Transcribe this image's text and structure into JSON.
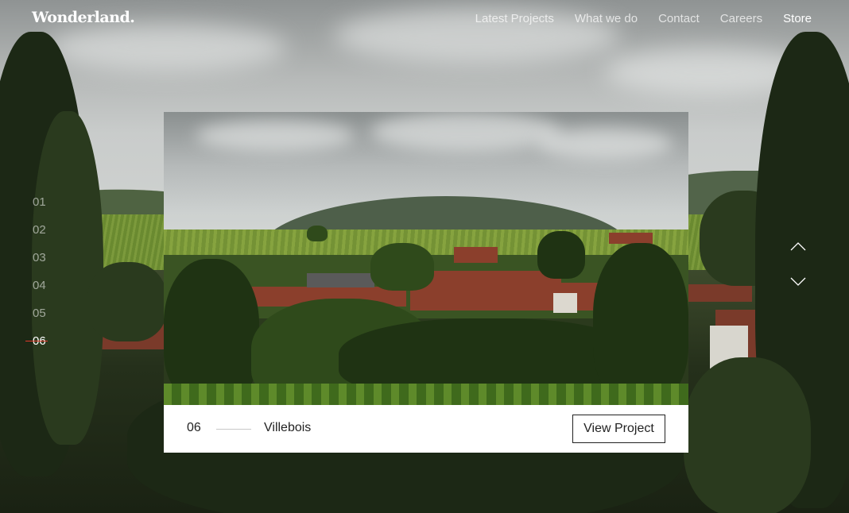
{
  "header": {
    "logo": "Wonderland.",
    "nav": [
      {
        "label": "Latest Projects",
        "active": false
      },
      {
        "label": "What we do",
        "active": false
      },
      {
        "label": "Contact",
        "active": false
      },
      {
        "label": "Careers",
        "active": false
      },
      {
        "label": "Store",
        "active": true
      }
    ]
  },
  "slides": {
    "items": [
      "01",
      "02",
      "03",
      "04",
      "05",
      "06"
    ],
    "active_index": 5,
    "active_marker_color": "#e0392b"
  },
  "controls": {
    "up_icon": "chevron-up-icon",
    "down_icon": "chevron-down-icon"
  },
  "project": {
    "number": "06",
    "title": "Villebois",
    "button_label": "View Project"
  }
}
